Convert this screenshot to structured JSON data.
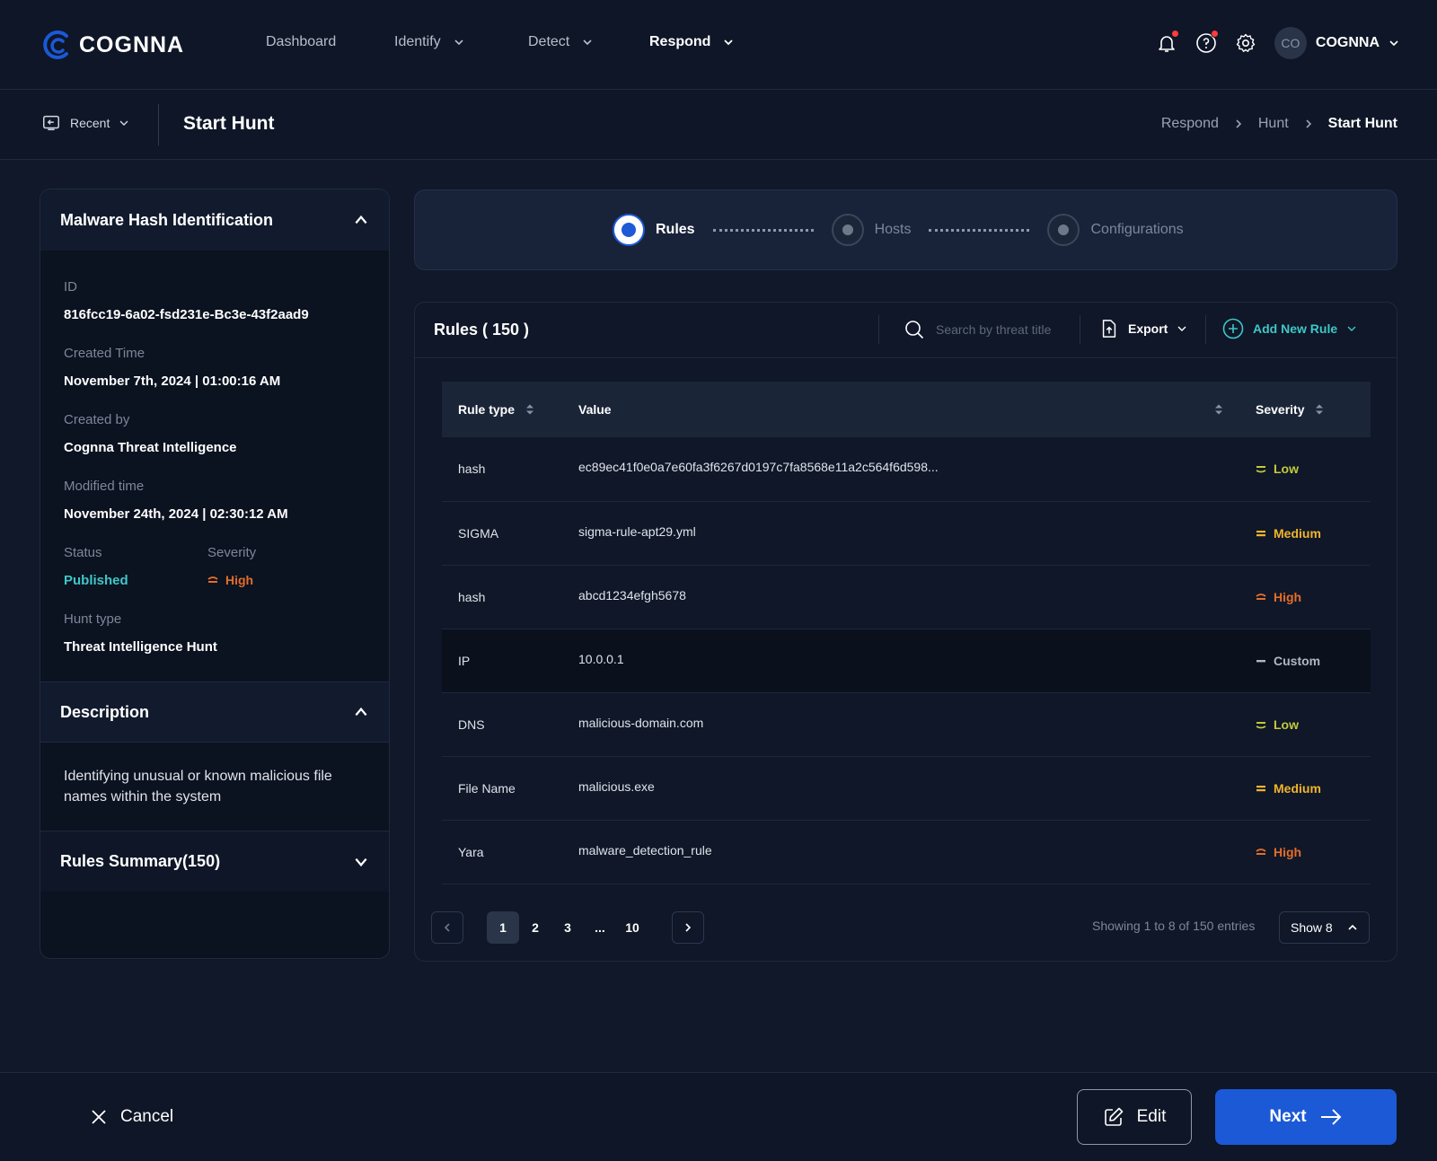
{
  "brand": {
    "name": "COGNNA",
    "accent": "#1b59d6",
    "teal": "#3fc7c7"
  },
  "nav": {
    "items": [
      {
        "label": "Dashboard"
      },
      {
        "label": "Identify"
      },
      {
        "label": "Detect"
      },
      {
        "label": "Respond"
      }
    ],
    "user": {
      "initials": "CO",
      "name": "COGNNA"
    }
  },
  "subheader": {
    "recent_label": "Recent",
    "title": "Start Hunt",
    "breadcrumb": [
      "Respond",
      "Hunt",
      "Start Hunt"
    ]
  },
  "details": {
    "title": "Malware Hash Identification",
    "id_label": "ID",
    "id_value": "816fcc19-6a02-fsd231e-Bc3e-43f2aad9",
    "created_time_label": "Created Time",
    "created_time_value": "November 7th, 2024 | 01:00:16 AM",
    "created_by_label": "Created by",
    "created_by_value": "Cognna Threat Intelligence",
    "modified_label": "Modified time",
    "modified_value": "November 24th, 2024 | 02:30:12 AM",
    "status_label": "Status",
    "status_value": "Published",
    "severity_label": "Severity",
    "severity_value": "High",
    "hunt_type_label": "Hunt type",
    "hunt_type_value": "Threat Intelligence Hunt",
    "description_title": "Description",
    "description_text": "Identifying unusual or known malicious file names within the system",
    "rules_summary_title": "Rules Summary(150)"
  },
  "stepper": {
    "steps": [
      {
        "label": "Rules",
        "state": "active"
      },
      {
        "label": "Hosts",
        "state": "inactive"
      },
      {
        "label": "Configurations",
        "state": "inactive"
      }
    ]
  },
  "rules": {
    "title": "Rules ( 150 )",
    "search_placeholder": "Search by threat title",
    "export_label": "Export",
    "add_label": "Add New Rule",
    "columns": [
      "Rule type",
      "Value",
      "Severity"
    ],
    "rows": [
      {
        "type": "hash",
        "value": "ec89ec41f0e0a7e60fa3f6267d0197c7fa8568e11a2c564f6d598...",
        "severity": "Low"
      },
      {
        "type": "SIGMA",
        "value": "sigma-rule-apt29.yml",
        "severity": "Medium"
      },
      {
        "type": "hash",
        "value": "abcd1234efgh5678",
        "severity": "High"
      },
      {
        "type": "IP",
        "value": "10.0.0.1",
        "severity": "Custom"
      },
      {
        "type": "DNS",
        "value": "malicious-domain.com",
        "severity": "Low"
      },
      {
        "type": "File Name",
        "value": "malicious.exe",
        "severity": "Medium"
      },
      {
        "type": "Yara",
        "value": "malware_detection_rule",
        "severity": "High"
      }
    ],
    "pagination": {
      "pages": [
        "1",
        "2",
        "3",
        "...",
        "10"
      ],
      "current": "1",
      "showing": "Showing 1 to 8 of 150 entries",
      "page_size_label": "Show 8"
    },
    "severity_colors": {
      "Low": "#c3c93e",
      "Medium": "#f1b52a",
      "High": "#e46d2a",
      "Custom": "#b0b7c3"
    }
  },
  "footer": {
    "cancel_label": "Cancel",
    "edit_label": "Edit",
    "next_label": "Next"
  }
}
